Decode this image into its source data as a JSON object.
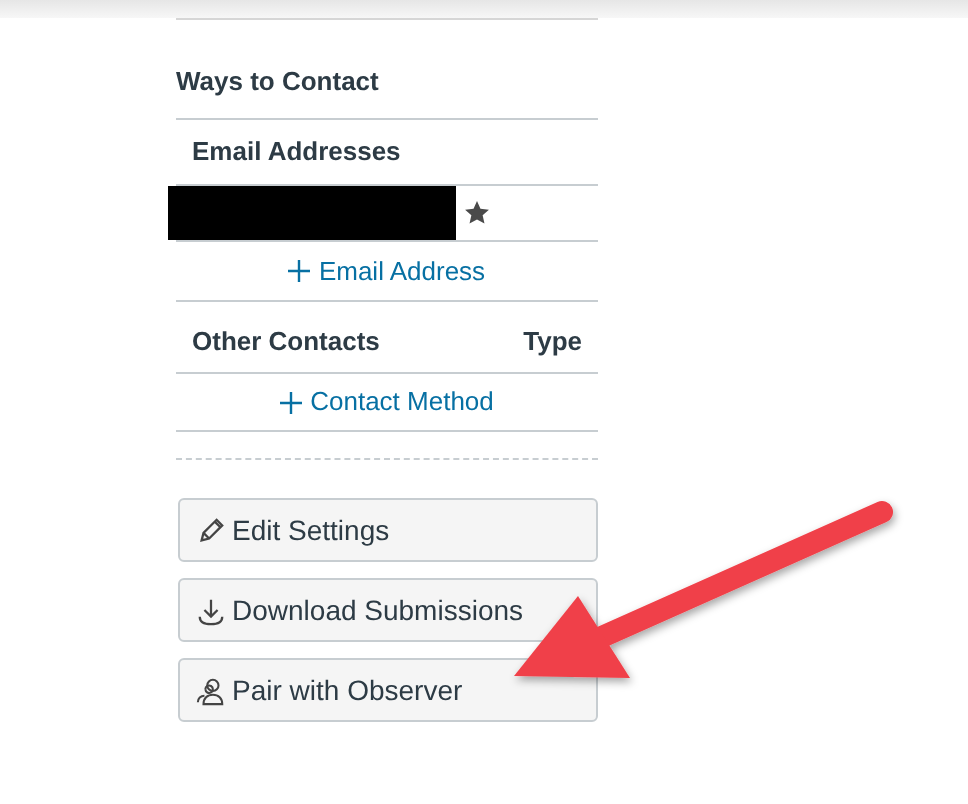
{
  "sections": [
    {
      "kind": "title",
      "label": "Ways to Contact"
    },
    {
      "kind": "list",
      "heading": "Email Addresses",
      "items": [
        {
          "redacted": true,
          "default": true
        }
      ],
      "add_label": "Email Address"
    },
    {
      "kind": "table",
      "heading": "Other Contacts",
      "column_2": "Type",
      "add_label": "Contact Method"
    }
  ],
  "buttons": [
    {
      "label": "Edit Settings",
      "kind": "edit"
    },
    {
      "label": "Download Submissions",
      "kind": "download"
    },
    {
      "label": "Pair with Observer",
      "kind": "pair"
    }
  ],
  "annotation": {
    "kind": "arrow"
  }
}
